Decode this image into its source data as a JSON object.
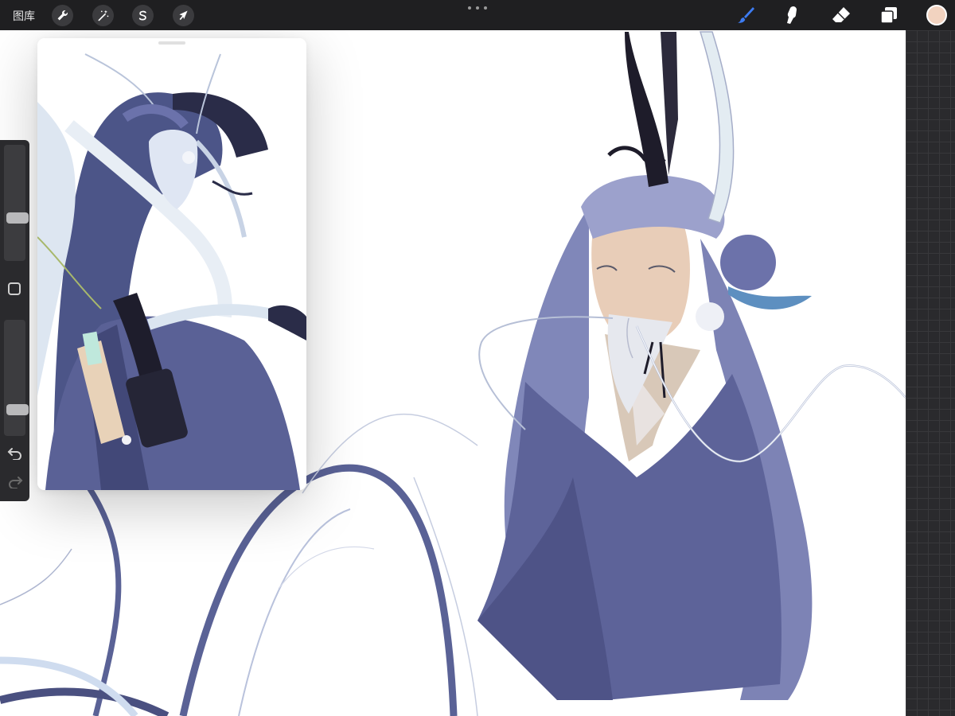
{
  "toolbar": {
    "gallery_label": "图库",
    "left_tools": [
      {
        "name": "actions",
        "icon": "wrench-icon"
      },
      {
        "name": "adjustments",
        "icon": "magic-wand-icon"
      },
      {
        "name": "selection",
        "icon": "selection-s-icon"
      },
      {
        "name": "transform",
        "icon": "arrow-cursor-icon"
      }
    ],
    "right_tools": [
      {
        "name": "brush",
        "icon": "brush-icon",
        "active": true
      },
      {
        "name": "smudge",
        "icon": "smudge-icon"
      },
      {
        "name": "eraser",
        "icon": "eraser-icon"
      },
      {
        "name": "layers",
        "icon": "layers-icon"
      }
    ],
    "active_color": "#f2d3c0",
    "active_tool_color": "#3d7cf2"
  },
  "sidebar": {
    "size_slider_level": 0.6,
    "opacity_slider_level": 0.85,
    "buttons": [
      "modify-button",
      "undo-button",
      "redo-button"
    ]
  },
  "reference_window": {
    "content": "reference-illustration"
  },
  "colors": {
    "toolbar_bg": "#1f1f21",
    "canvas_bg": "#ffffff",
    "sidebar_bg": "#2a2a2d",
    "art_purple": "#5a6296",
    "art_light_blue": "#cfdff0"
  }
}
